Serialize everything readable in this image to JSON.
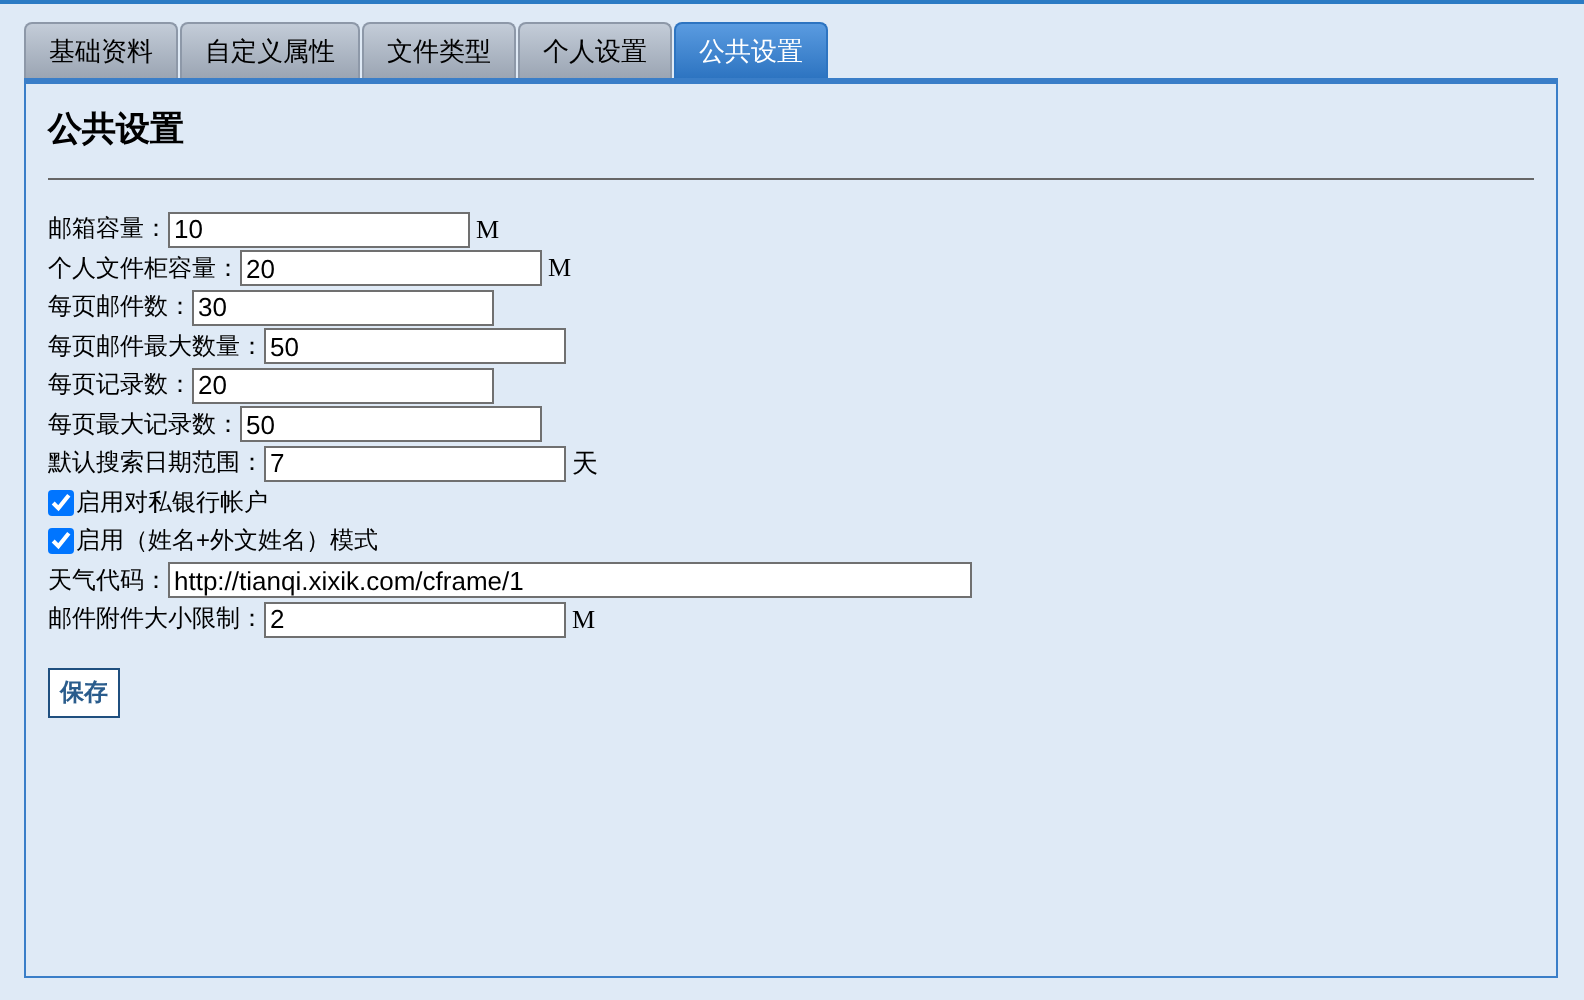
{
  "tabs": [
    {
      "label": "基础资料",
      "selected": false
    },
    {
      "label": "自定义属性",
      "selected": false
    },
    {
      "label": "文件类型",
      "selected": false
    },
    {
      "label": "个人设置",
      "selected": false
    },
    {
      "label": "公共设置",
      "selected": true
    }
  ],
  "heading": "公共设置",
  "fields": [
    {
      "kind": "text",
      "label": "邮箱容量：",
      "value": "10",
      "unit": "M"
    },
    {
      "kind": "text",
      "label": "个人文件柜容量：",
      "value": "20",
      "unit": "M"
    },
    {
      "kind": "text",
      "label": "每页邮件数：",
      "value": "30"
    },
    {
      "kind": "text",
      "label": "每页邮件最大数量：",
      "value": "50"
    },
    {
      "kind": "text",
      "label": "每页记录数：",
      "value": "20"
    },
    {
      "kind": "text",
      "label": "每页最大记录数：",
      "value": "50"
    },
    {
      "kind": "text",
      "label": "默认搜索日期范围：",
      "value": "7",
      "unit": "天"
    },
    {
      "kind": "checkbox",
      "label": "启用对私银行帐户",
      "checked": true
    },
    {
      "kind": "checkbox",
      "label": "启用（姓名+外文姓名）模式",
      "checked": true
    },
    {
      "kind": "wide",
      "label": "天气代码：",
      "value": "http://tianqi.xixik.com/cframe/1"
    },
    {
      "kind": "text",
      "label": "邮件附件大小限制：",
      "value": "2",
      "unit": "M"
    }
  ],
  "save_button": "保存"
}
